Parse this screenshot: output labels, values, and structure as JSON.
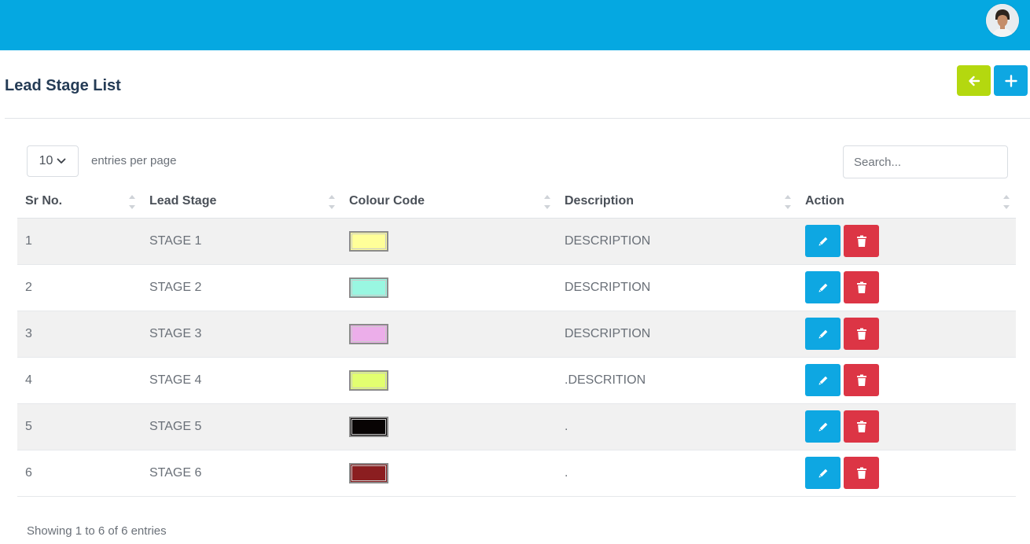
{
  "header": {
    "avatar_icon": "user-avatar"
  },
  "page": {
    "title": "Lead Stage List",
    "back_icon": "arrow-left-icon",
    "add_icon": "plus-icon"
  },
  "controls": {
    "per_page_value": "10",
    "per_page_label": "entries per page",
    "search_placeholder": "Search..."
  },
  "table": {
    "columns": [
      "Sr No.",
      "Lead Stage",
      "Colour Code",
      "Description",
      "Action"
    ],
    "rows": [
      {
        "sr": "1",
        "stage": "STAGE 1",
        "color": "#ffff99",
        "description": "DESCRIPTION"
      },
      {
        "sr": "2",
        "stage": "STAGE 2",
        "color": "#99f7e1",
        "description": "DESCRIPTION"
      },
      {
        "sr": "3",
        "stage": "STAGE 3",
        "color": "#ecaeea",
        "description": "DESCRIPTION"
      },
      {
        "sr": "4",
        "stage": "STAGE 4",
        "color": "#e2ff70",
        "description": ".DESCRITION"
      },
      {
        "sr": "5",
        "stage": "STAGE 5",
        "color": "#080404",
        "description": "."
      },
      {
        "sr": "6",
        "stage": "STAGE 6",
        "color": "#8b1e20",
        "description": "."
      }
    ]
  },
  "footer": {
    "info": "Showing 1 to 6 of 6 entries"
  },
  "colors": {
    "topbar": "#05a8e1",
    "back_button": "#b4d80f",
    "add_button": "#0ea7e2",
    "edit_button": "#0ea7e2",
    "delete_button": "#dc3545"
  }
}
